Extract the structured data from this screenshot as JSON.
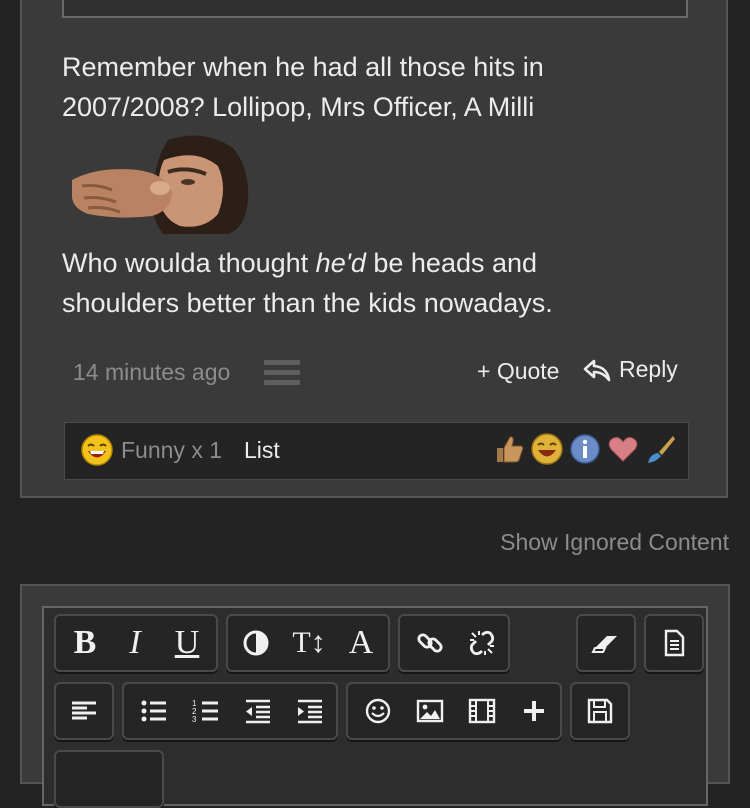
{
  "post": {
    "paragraph1_line1": "Remember when he had all those hits in",
    "paragraph1_line2": "2007/2008? Lollipop, Mrs Officer, A Milli",
    "paragraph2_line1_before": "Who woulda thought ",
    "paragraph2_line1_emph": "he'd",
    "paragraph2_line1_after": " be heads and",
    "paragraph2_line2": "shoulders better than the kids nowadays.",
    "timestamp": "14 minutes ago",
    "quote_label": "+ Quote",
    "reply_label": "Reply"
  },
  "reactions": {
    "summary": "Funny x 1",
    "list_label": "List",
    "icons": [
      "thumbs-up",
      "funny",
      "info",
      "heart",
      "paintbrush"
    ]
  },
  "ignored": {
    "label": "Show Ignored Content"
  },
  "toolbar": {
    "bold": "B",
    "italic": "I",
    "underline": "U",
    "font_size": "T↕",
    "font_family": "A"
  },
  "colors": {
    "background": "#232323",
    "panel": "#3a3a3a",
    "text": "#ececec",
    "muted": "#8c8c8c"
  }
}
